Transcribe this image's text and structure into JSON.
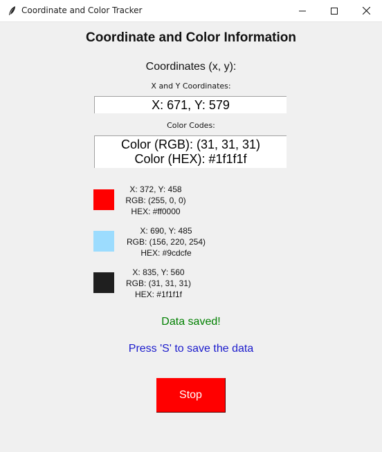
{
  "window": {
    "title": "Coordinate and Color Tracker",
    "app_icon": "feather-icon",
    "controls": [
      "minimize-icon",
      "maximize-icon",
      "close-icon"
    ]
  },
  "main": {
    "heading": "Coordinate and Color Information",
    "coordinates_title": "Coordinates (x, y):",
    "xy_label": "X and Y Coordinates:",
    "xy_value": "X: 671, Y: 579",
    "color_label": "Color Codes:",
    "color_rgb": "Color (RGB): (31, 31, 31)",
    "color_hex": "Color (HEX): #1f1f1f"
  },
  "entries": [
    {
      "swatch_color": "#ff0000",
      "coords": "X: 372, Y: 458",
      "rgb": "RGB: (255, 0, 0)",
      "hex": "HEX: #ff0000"
    },
    {
      "swatch_color": "#9cdcfe",
      "coords": "X: 690, Y: 485",
      "rgb": "RGB: (156, 220, 254)",
      "hex": "HEX: #9cdcfe"
    },
    {
      "swatch_color": "#1f1f1f",
      "coords": "X: 835, Y: 560",
      "rgb": "RGB: (31, 31, 31)",
      "hex": "HEX: #1f1f1f"
    }
  ],
  "status": {
    "saved": "Data saved!",
    "saved_color": "#008000",
    "hint": "Press 'S' to save the data",
    "hint_color": "#1a1acc"
  },
  "stop_button": {
    "label": "Stop",
    "background": "#ff0000"
  }
}
